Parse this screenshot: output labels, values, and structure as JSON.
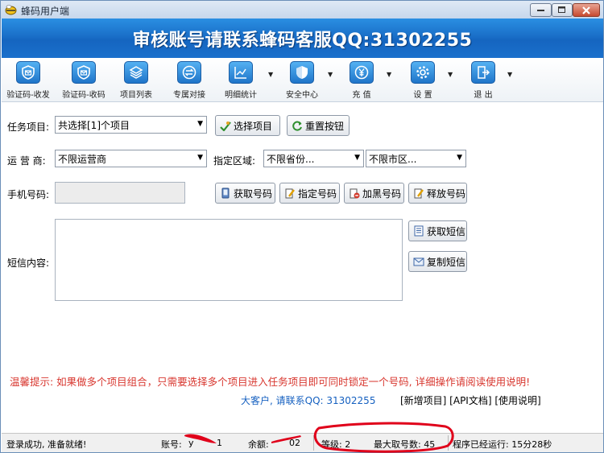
{
  "window": {
    "title": "蜂码用户端"
  },
  "banner": {
    "text": "审核账号请联系蜂码客服QQ:31302255"
  },
  "toolbar": {
    "items": [
      {
        "label": "验证码-收发",
        "icon": "shield-mail-icon"
      },
      {
        "label": "验证码-收码",
        "icon": "shield-check-icon"
      },
      {
        "label": "项目列表",
        "icon": "layers-icon"
      },
      {
        "label": "专属对接",
        "icon": "swap-icon"
      },
      {
        "label": "明细统计",
        "icon": "chart-icon"
      },
      {
        "label": "安全中心",
        "icon": "shield-icon"
      },
      {
        "label": "充 值",
        "icon": "yen-icon"
      },
      {
        "label": "设 置",
        "icon": "gear-icon"
      },
      {
        "label": "退 出",
        "icon": "exit-icon"
      }
    ]
  },
  "form": {
    "task_label": "任务项目:",
    "task_value": "共选择[1]个项目",
    "select_project_btn": "选择项目",
    "reset_btn": "重置按钮",
    "carrier_label": "运 营 商:",
    "carrier_value": "不限运营商",
    "region_label": "指定区域:",
    "province_value": "不限省份...",
    "city_value": "不限市区...",
    "phone_label": "手机号码:",
    "get_number_btn": "获取号码",
    "specify_number_btn": "指定号码",
    "blacklist_btn": "加黑号码",
    "release_btn": "释放号码",
    "sms_label": "短信内容:",
    "get_sms_btn": "获取短信",
    "copy_sms_btn": "复制短信"
  },
  "tip": {
    "text": "温馨提示: 如果做多个项目组合，只需要选择多个项目进入任务项目即可同时锁定一个号码, 详细操作请阅读使用说明!"
  },
  "contact": {
    "text": "大客户, 请联系QQ: 31302255"
  },
  "links": {
    "text": "[新增项目] [API文档] [使用说明]"
  },
  "status": {
    "message": "登录成功, 准备就绪!",
    "account_label": "账号:",
    "account_value": "y",
    "account_tail": "1",
    "balance_label": "余额:",
    "balance_tail": "02",
    "level_text": "等级: 2",
    "max_numbers_text": "最大取号数: 45",
    "runtime_text": "程序已经运行: 15分28秒"
  },
  "colors": {
    "banner": "#1a6fc8",
    "tip": "#d8372f",
    "contact": "#1560c0",
    "annotation": "#e0001a"
  }
}
